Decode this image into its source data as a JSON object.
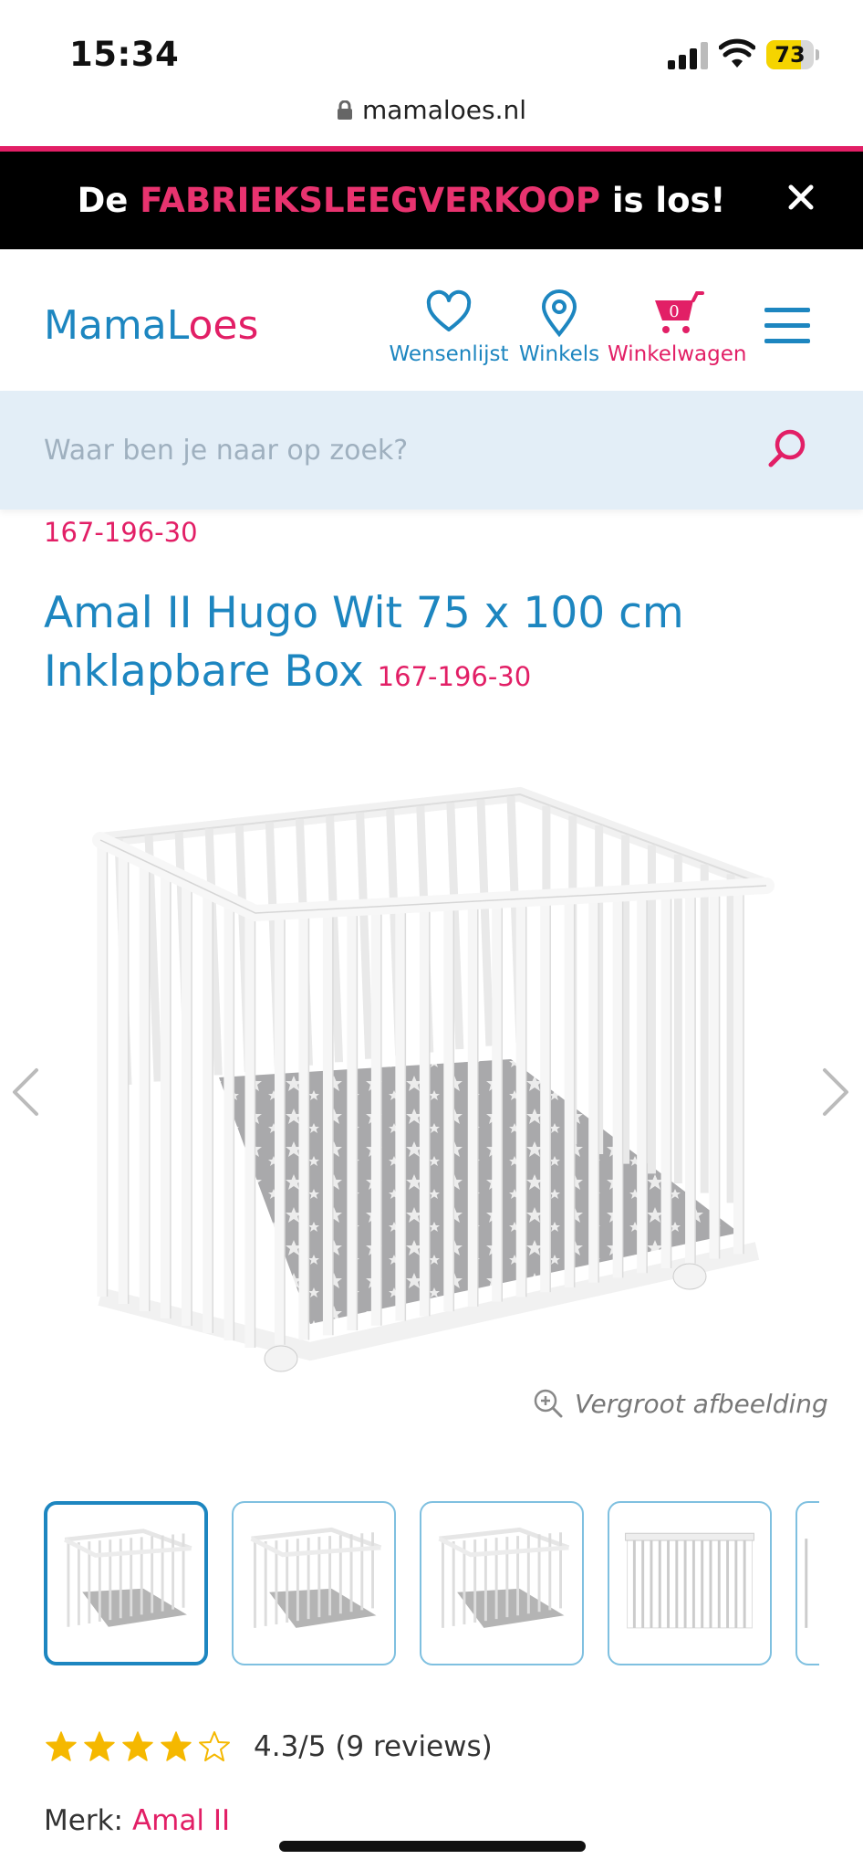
{
  "status_bar": {
    "time": "15:34",
    "battery": "73",
    "battery_level": 0.73
  },
  "browser": {
    "url": "mamaloes.nl"
  },
  "promo": {
    "text_before": "De ",
    "highlight": "FABRIEKSLEEGVERKOOP",
    "text_after": " is los!"
  },
  "header": {
    "logo_part1": "MamaL",
    "logo_part2": "oes",
    "nav": {
      "wishlist": "Wensenlijst",
      "stores": "Winkels",
      "cart": "Winkelwagen",
      "cart_count": "0"
    }
  },
  "search": {
    "placeholder": "Waar ben je naar op zoek?"
  },
  "product": {
    "sku": "167-196-30",
    "title": "Amal II Hugo Wit 75 x 100 cm Inklapbare Box",
    "zoom_label": "Vergroot afbeelding",
    "rating_text": "4.3/5 (9 reviews)",
    "rating_value": 4.3,
    "rating_max": 5,
    "brand_label": "Merk:",
    "brand_value": "Amal II"
  },
  "colors": {
    "brand_blue": "#1d86c0",
    "brand_pink": "#e21f66",
    "star": "#f5b800"
  }
}
